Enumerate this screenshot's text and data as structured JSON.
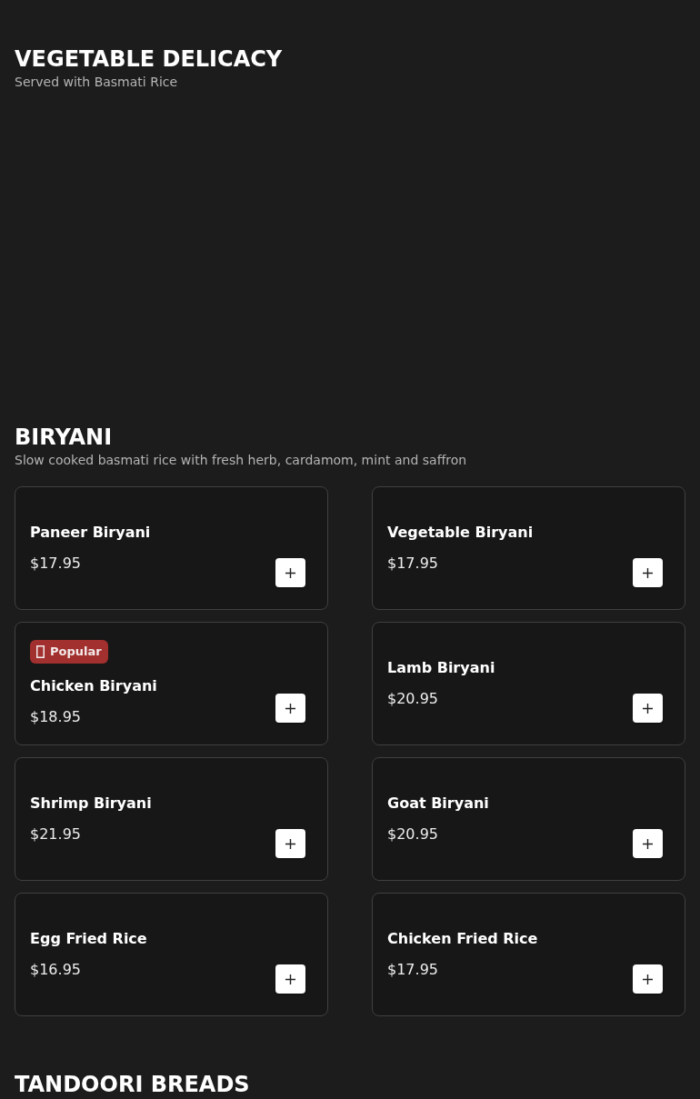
{
  "sections": [
    {
      "title": "VEGETABLE DELICACY",
      "subtitle": "Served with Basmati Rice"
    },
    {
      "title": "BIRYANI",
      "subtitle": "Slow cooked basmati rice with fresh herb, cardamom, mint and saffron",
      "items": [
        {
          "name": "Paneer Biryani",
          "price": "$17.95"
        },
        {
          "name": "Vegetable Biryani",
          "price": "$17.95"
        },
        {
          "name": "Chicken Biryani",
          "price": "$18.95",
          "badge": "Popular"
        },
        {
          "name": "Lamb Biryani",
          "price": "$20.95"
        },
        {
          "name": "Shrimp Biryani",
          "price": "$21.95"
        },
        {
          "name": "Goat Biryani",
          "price": "$20.95"
        },
        {
          "name": "Egg Fried Rice",
          "price": "$16.95"
        },
        {
          "name": "Chicken Fried Rice",
          "price": "$17.95"
        }
      ]
    },
    {
      "title": "TANDOORI BREADS"
    }
  ]
}
